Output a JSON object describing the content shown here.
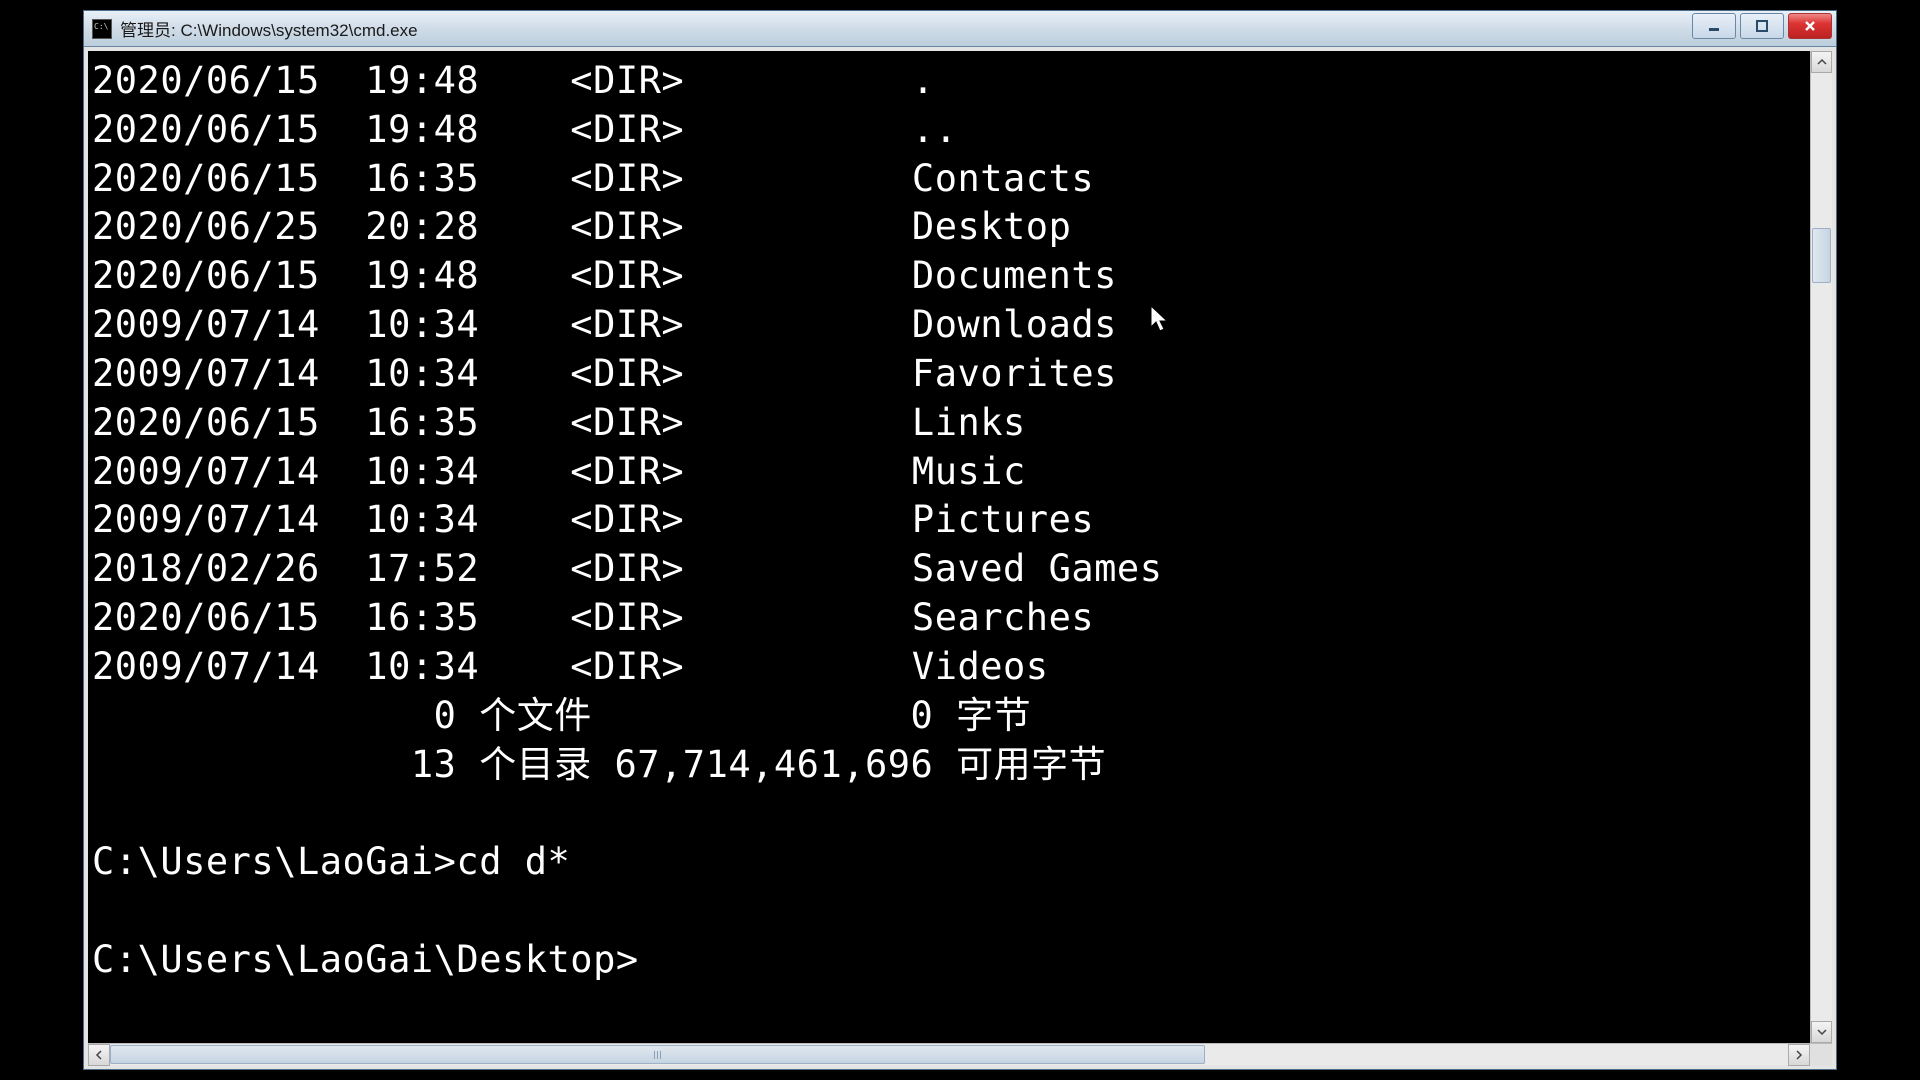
{
  "window": {
    "title": "管理员: C:\\Windows\\system32\\cmd.exe"
  },
  "listing": {
    "rows": [
      {
        "date": "2020/06/15",
        "time": "19:48",
        "type": "<DIR>",
        "name": "."
      },
      {
        "date": "2020/06/15",
        "time": "19:48",
        "type": "<DIR>",
        "name": ".."
      },
      {
        "date": "2020/06/15",
        "time": "16:35",
        "type": "<DIR>",
        "name": "Contacts"
      },
      {
        "date": "2020/06/25",
        "time": "20:28",
        "type": "<DIR>",
        "name": "Desktop"
      },
      {
        "date": "2020/06/15",
        "time": "19:48",
        "type": "<DIR>",
        "name": "Documents"
      },
      {
        "date": "2009/07/14",
        "time": "10:34",
        "type": "<DIR>",
        "name": "Downloads"
      },
      {
        "date": "2009/07/14",
        "time": "10:34",
        "type": "<DIR>",
        "name": "Favorites"
      },
      {
        "date": "2020/06/15",
        "time": "16:35",
        "type": "<DIR>",
        "name": "Links"
      },
      {
        "date": "2009/07/14",
        "time": "10:34",
        "type": "<DIR>",
        "name": "Music"
      },
      {
        "date": "2009/07/14",
        "time": "10:34",
        "type": "<DIR>",
        "name": "Pictures"
      },
      {
        "date": "2018/02/26",
        "time": "17:52",
        "type": "<DIR>",
        "name": "Saved Games"
      },
      {
        "date": "2020/06/15",
        "time": "16:35",
        "type": "<DIR>",
        "name": "Searches"
      },
      {
        "date": "2009/07/14",
        "time": "10:34",
        "type": "<DIR>",
        "name": "Videos"
      }
    ],
    "summary_files": "               0 个文件              0 字节",
    "summary_dirs": "              13 个目录 67,714,461,696 可用字节"
  },
  "prompts": {
    "p1_prompt": "C:\\Users\\LaoGai>",
    "p1_command": "cd d*",
    "p2_prompt": "C:\\Users\\LaoGai\\Desktop>"
  }
}
